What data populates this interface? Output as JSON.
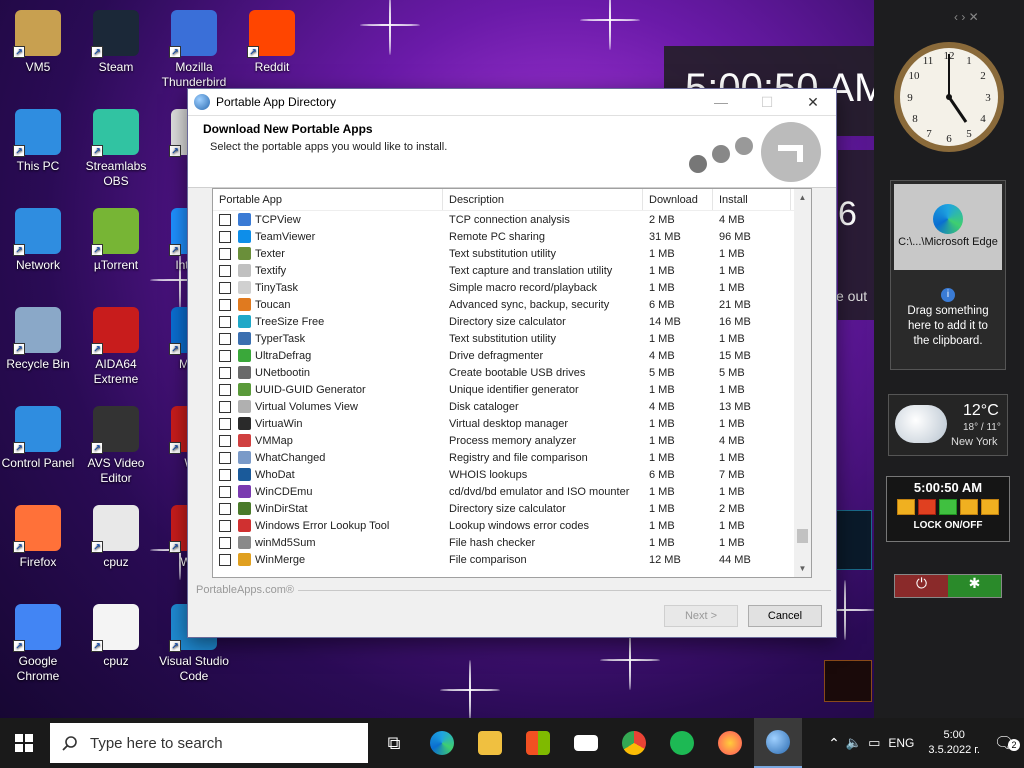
{
  "desktop_icons": [
    {
      "label": "VM5",
      "color": "#c8a050"
    },
    {
      "label": "Steam",
      "color": "#1b2838"
    },
    {
      "label": "Mozilla Thunderbird",
      "color": "#3a6fd8"
    },
    {
      "label": "Reddit",
      "color": "#ff4500"
    },
    {
      "label": "This PC",
      "color": "#2f8de0"
    },
    {
      "label": "Streamlabs OBS",
      "color": "#31c3a2"
    },
    {
      "label": "de",
      "color": "#dddddd"
    },
    {
      "label": "Network",
      "color": "#2f8de0"
    },
    {
      "label": "µTorrent",
      "color": "#77b535"
    },
    {
      "label": "Int Exp",
      "color": "#1e90ff"
    },
    {
      "label": "Recycle Bin",
      "color": "#8aa8c8"
    },
    {
      "label": "AIDA64 Extreme",
      "color": "#c81c1c"
    },
    {
      "label": "Mic E",
      "color": "#0a6ed1"
    },
    {
      "label": "Control Panel",
      "color": "#2f8de0"
    },
    {
      "label": "AVS Video Editor",
      "color": "#333333"
    },
    {
      "label": "WP",
      "color": "#c81c1c"
    },
    {
      "label": "Firefox",
      "color": "#ff7139"
    },
    {
      "label": "cpuz",
      "color": "#e8e8e8"
    },
    {
      "label": "WPS",
      "color": "#c81c1c"
    },
    {
      "label": "Google Chrome",
      "color": "#4285f4"
    },
    {
      "label": "cpuz",
      "color": "#f4f4f4"
    },
    {
      "label": "Visual Studio Code",
      "color": "#1f8ad2"
    }
  ],
  "sidebar": {
    "clock_time": "5:00:50 AM",
    "partial_text_1": "6",
    "partial_text_2": "e out",
    "clipboard_title": "C:\\...\\Microsoft Edge",
    "clipboard_hint": "Drag something here to add it to the clipboard.",
    "weather_temp": "12°C",
    "weather_range": "18° / 11°",
    "weather_city": "New York",
    "lock_label": "LOCK ON/OFF"
  },
  "dialog": {
    "title": "Portable App Directory",
    "header_title": "Download New Portable Apps",
    "header_subtitle": "Select the portable apps you would like to install.",
    "columns": {
      "name": "Portable App",
      "desc": "Description",
      "download": "Download",
      "install": "Install"
    },
    "rows": [
      {
        "name": "TCPView",
        "desc": "TCP connection analysis",
        "download": "2 MB",
        "install": "4 MB",
        "icon_color": "#3a7bd5"
      },
      {
        "name": "TeamViewer",
        "desc": "Remote PC sharing",
        "download": "31 MB",
        "install": "96 MB",
        "icon_color": "#0e8ee9"
      },
      {
        "name": "Texter",
        "desc": "Text substitution utility",
        "download": "1 MB",
        "install": "1 MB",
        "icon_color": "#6a8f3a"
      },
      {
        "name": "Textify",
        "desc": "Text capture and translation utility",
        "download": "1 MB",
        "install": "1 MB",
        "icon_color": "#c0c0c0"
      },
      {
        "name": "TinyTask",
        "desc": "Simple macro record/playback",
        "download": "1 MB",
        "install": "1 MB",
        "icon_color": "#d0d0d0"
      },
      {
        "name": "Toucan",
        "desc": "Advanced sync, backup, security",
        "download": "6 MB",
        "install": "21 MB",
        "icon_color": "#e07a1f"
      },
      {
        "name": "TreeSize Free",
        "desc": "Directory size calculator",
        "download": "14 MB",
        "install": "16 MB",
        "icon_color": "#1fa8c8"
      },
      {
        "name": "TyperTask",
        "desc": "Text substitution utility",
        "download": "1 MB",
        "install": "1 MB",
        "icon_color": "#3a6fb0"
      },
      {
        "name": "UltraDefrag",
        "desc": "Drive defragmenter",
        "download": "4 MB",
        "install": "15 MB",
        "icon_color": "#3aa83a"
      },
      {
        "name": "UNetbootin",
        "desc": "Create bootable USB drives",
        "download": "5 MB",
        "install": "5 MB",
        "icon_color": "#6a6a6a"
      },
      {
        "name": "UUID-GUID Generator",
        "desc": "Unique identifier generator",
        "download": "1 MB",
        "install": "1 MB",
        "icon_color": "#5a9a3a"
      },
      {
        "name": "Virtual Volumes View",
        "desc": "Disk cataloger",
        "download": "4 MB",
        "install": "13 MB",
        "icon_color": "#b0b0b0"
      },
      {
        "name": "VirtuaWin",
        "desc": "Virtual desktop manager",
        "download": "1 MB",
        "install": "1 MB",
        "icon_color": "#2a2a2a"
      },
      {
        "name": "VMMap",
        "desc": "Process memory analyzer",
        "download": "1 MB",
        "install": "4 MB",
        "icon_color": "#d04040"
      },
      {
        "name": "WhatChanged",
        "desc": "Registry and file comparison",
        "download": "1 MB",
        "install": "1 MB",
        "icon_color": "#7a9ac8"
      },
      {
        "name": "WhoDat",
        "desc": "WHOIS lookups",
        "download": "6 MB",
        "install": "7 MB",
        "icon_color": "#1a5a9a"
      },
      {
        "name": "WinCDEmu",
        "desc": "cd/dvd/bd emulator and ISO mounter",
        "download": "1 MB",
        "install": "1 MB",
        "icon_color": "#7a3ab0"
      },
      {
        "name": "WinDirStat",
        "desc": "Directory size calculator",
        "download": "1 MB",
        "install": "2 MB",
        "icon_color": "#4a7a2a"
      },
      {
        "name": "Windows Error Lookup Tool",
        "desc": "Lookup windows error codes",
        "download": "1 MB",
        "install": "1 MB",
        "icon_color": "#d03030"
      },
      {
        "name": "winMd5Sum",
        "desc": "File hash checker",
        "download": "1 MB",
        "install": "1 MB",
        "icon_color": "#8a8a8a"
      },
      {
        "name": "WinMerge",
        "desc": "File comparison",
        "download": "12 MB",
        "install": "44 MB",
        "icon_color": "#e0a020"
      }
    ],
    "footer_brand": "PortableApps.com®",
    "next_label": "Next >",
    "cancel_label": "Cancel"
  },
  "taskbar": {
    "search_placeholder": "Type here to search",
    "language": "ENG",
    "time": "5:00",
    "date": "3.5.2022 г.",
    "notification_count": "2"
  }
}
